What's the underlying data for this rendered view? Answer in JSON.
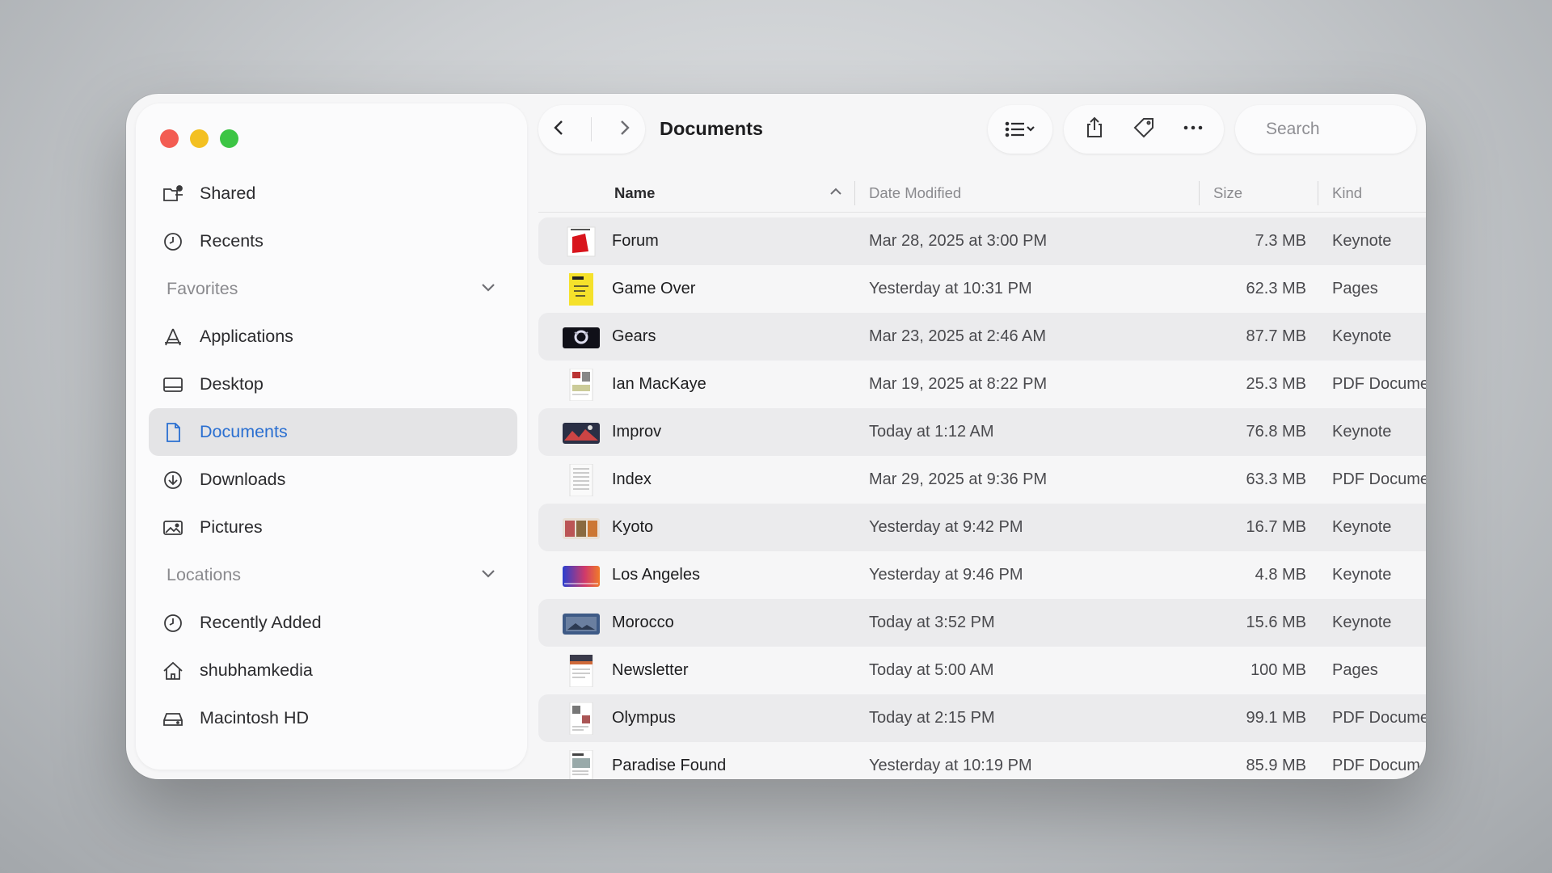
{
  "window": {
    "title": "Documents"
  },
  "sidebar": {
    "top_items": [
      {
        "label": "Shared",
        "icon": "shared-folder-icon"
      },
      {
        "label": "Recents",
        "icon": "clock-icon"
      }
    ],
    "favorites_label": "Favorites",
    "favorites": [
      {
        "label": "Applications",
        "icon": "applications-icon"
      },
      {
        "label": "Desktop",
        "icon": "desktop-icon"
      },
      {
        "label": "Documents",
        "icon": "document-icon",
        "active": true
      },
      {
        "label": "Downloads",
        "icon": "download-icon"
      },
      {
        "label": "Pictures",
        "icon": "photo-icon"
      }
    ],
    "locations_label": "Locations",
    "locations": [
      {
        "label": "Recently Added",
        "icon": "clock-icon"
      },
      {
        "label": "shubhamkedia",
        "icon": "home-icon"
      },
      {
        "label": "Macintosh HD",
        "icon": "drive-icon"
      }
    ]
  },
  "search": {
    "placeholder": "Search"
  },
  "table": {
    "columns": {
      "name": "Name",
      "date": "Date Modified",
      "size": "Size",
      "kind": "Kind"
    },
    "rows": [
      {
        "name": "Forum",
        "date": "Mar 28, 2025 at 3:00 PM",
        "size": "7.3 MB",
        "kind": "Keynote"
      },
      {
        "name": "Game Over",
        "date": "Yesterday at 10:31 PM",
        "size": "62.3 MB",
        "kind": "Pages"
      },
      {
        "name": "Gears",
        "date": "Mar 23, 2025 at 2:46 AM",
        "size": "87.7 MB",
        "kind": "Keynote"
      },
      {
        "name": "Ian MacKaye",
        "date": "Mar 19, 2025 at 8:22 PM",
        "size": "25.3 MB",
        "kind": "PDF Document"
      },
      {
        "name": "Improv",
        "date": "Today at 1:12 AM",
        "size": "76.8 MB",
        "kind": "Keynote"
      },
      {
        "name": "Index",
        "date": "Mar 29, 2025 at 9:36 PM",
        "size": "63.3 MB",
        "kind": "PDF Document"
      },
      {
        "name": "Kyoto",
        "date": "Yesterday at 9:42 PM",
        "size": "16.7 MB",
        "kind": "Keynote"
      },
      {
        "name": "Los Angeles",
        "date": "Yesterday at 9:46 PM",
        "size": "4.8 MB",
        "kind": "Keynote"
      },
      {
        "name": "Morocco",
        "date": "Today at 3:52 PM",
        "size": "15.6 MB",
        "kind": "Keynote"
      },
      {
        "name": "Newsletter",
        "date": "Today at 5:00 AM",
        "size": "100 MB",
        "kind": "Pages"
      },
      {
        "name": "Olympus",
        "date": "Today at 2:15 PM",
        "size": "99.1 MB",
        "kind": "PDF Document"
      },
      {
        "name": "Paradise Found",
        "date": "Yesterday at 10:19 PM",
        "size": "85.9 MB",
        "kind": "PDF Document"
      }
    ]
  },
  "colors": {
    "accent": "#2a6fd1",
    "close": "#f35c52",
    "minimize": "#f3c021",
    "maximize": "#3cc544"
  }
}
